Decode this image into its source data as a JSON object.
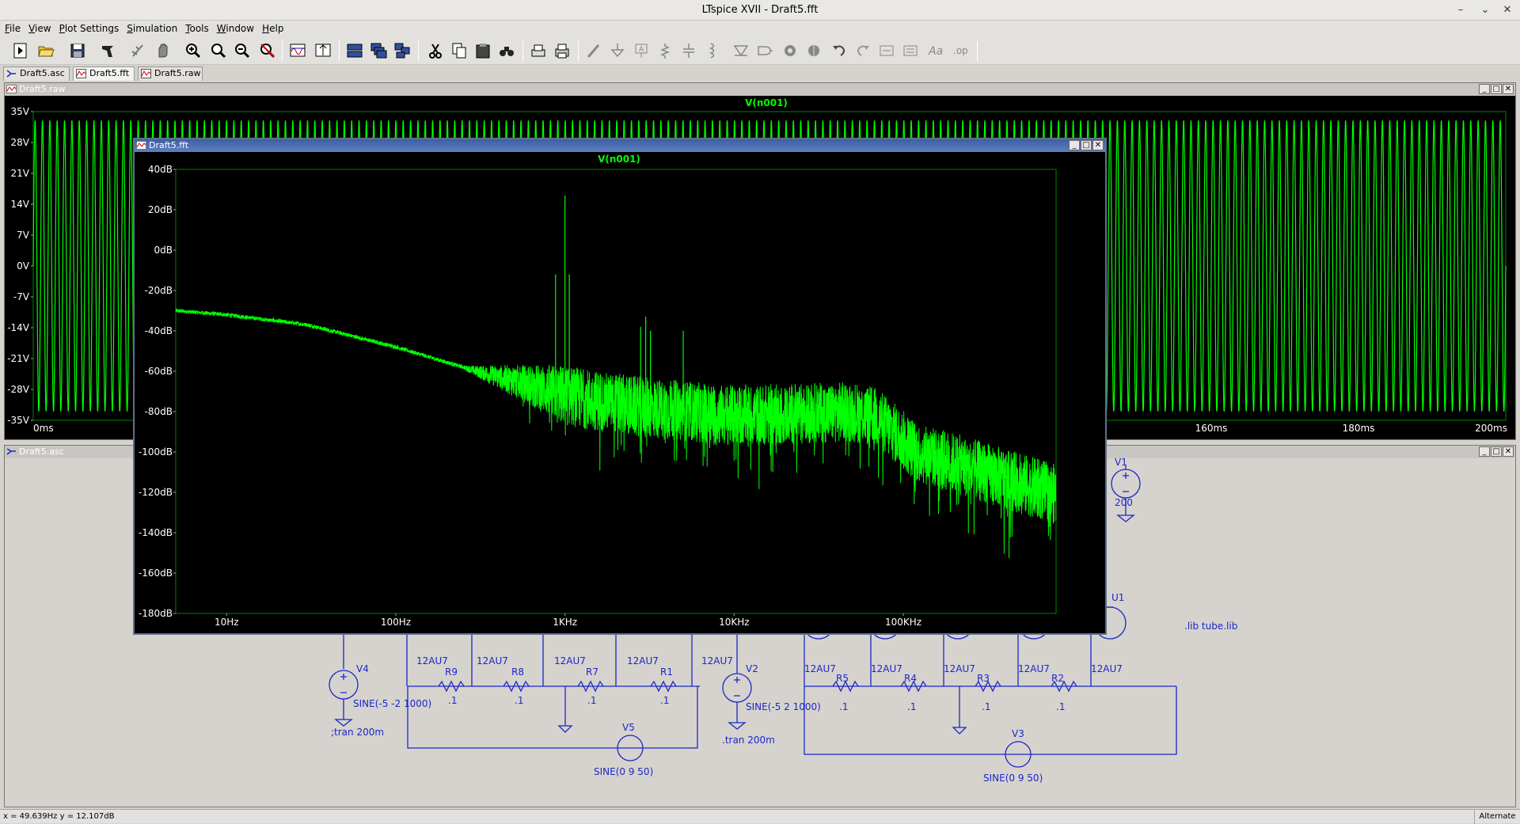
{
  "window": {
    "title": "LTspice XVII - Draft5.fft"
  },
  "menu": [
    "File",
    "View",
    "Plot Settings",
    "Simulation",
    "Tools",
    "Window",
    "Help"
  ],
  "toolbar_icons": [
    "new-schematic-icon",
    "open-icon",
    "save-icon",
    "control-panel-icon",
    "run-icon",
    "halt-icon",
    "zoom-in-icon",
    "zoom-fit-icon",
    "zoom-out-icon",
    "zoom-cancel-icon",
    "autorange-x-icon",
    "autorange-y-icon",
    "tile-horizontal-icon",
    "cascade-icon",
    "tile-vertical-icon",
    "cut-icon",
    "copy-icon",
    "paste-icon",
    "find-icon",
    "print-preview-icon",
    "print-icon",
    "wire-icon",
    "ground-icon",
    "label-net-icon",
    "resistor-icon",
    "capacitor-icon",
    "inductor-icon",
    "diode-icon",
    "component-icon",
    "rotate-icon",
    "mirror-icon",
    "undo-icon",
    "redo-icon",
    "move-icon",
    "drag-icon",
    "text-icon",
    "spice-directive-icon"
  ],
  "tabs": [
    {
      "label": "Draft5.asc",
      "icon": "schematic-icon"
    },
    {
      "label": "Draft5.fft",
      "icon": "waveform-icon"
    },
    {
      "label": "Draft5.raw",
      "icon": "waveform-icon"
    }
  ],
  "raw_window": {
    "title": "Draft5.raw",
    "chart_data": {
      "type": "line",
      "title": "V(n001)",
      "ylim": [
        -35,
        35
      ],
      "xlim": [
        0,
        200
      ],
      "x_unit": "ms",
      "y_ticks": [
        "35V",
        "28V",
        "21V",
        "14V",
        "7V",
        "0V",
        "-7V",
        "-14V",
        "-21V",
        "-28V",
        "-35V"
      ],
      "x_ticks": [
        "0ms",
        "160ms",
        "180ms",
        "200ms"
      ],
      "series": [
        {
          "name": "V(n001)",
          "waveform": "sine",
          "frequency_hz": 1000,
          "amplitude_v": 33,
          "color": "#00ff00"
        }
      ],
      "grid": false
    }
  },
  "fft_window": {
    "title": "Draft5.fft",
    "chart_data": {
      "type": "line",
      "title": "V(n001)",
      "x_scale": "log",
      "xlim": [
        5,
        800000
      ],
      "ylim": [
        -180,
        40
      ],
      "x_ticks": [
        "10Hz",
        "100Hz",
        "1KHz",
        "10KHz",
        "100KHz"
      ],
      "y_ticks": [
        "40dB",
        "20dB",
        "0dB",
        "-20dB",
        "-40dB",
        "-60dB",
        "-80dB",
        "-100dB",
        "-120dB",
        "-140dB",
        "-160dB",
        "-180dB"
      ],
      "series": [
        {
          "name": "V(n001)",
          "color": "#00ff00",
          "x": [
            5,
            10,
            30,
            100,
            300,
            700,
            1000,
            2000,
            3000,
            10000,
            50000,
            70000,
            120000,
            300000,
            800000
          ],
          "y": [
            -30,
            -32,
            -37,
            -48,
            -60,
            -68,
            -72,
            -76,
            -78,
            -82,
            -80,
            -83,
            -100,
            -110,
            -121
          ],
          "peaks": [
            {
              "x": 1000,
              "y": 27
            },
            {
              "x": 880,
              "y": -12
            },
            {
              "x": 1060,
              "y": -12
            },
            {
              "x": 3000,
              "y": -33
            },
            {
              "x": 2800,
              "y": -38
            },
            {
              "x": 3200,
              "y": -40
            },
            {
              "x": 5000,
              "y": -40
            }
          ]
        }
      ],
      "grid": false
    }
  },
  "asc_window": {
    "title": "Draft5.asc",
    "components": {
      "V1": {
        "name": "V1",
        "value": "200"
      },
      "V4": {
        "name": "V4",
        "value": "SINE(-5 -2 1000)",
        "directive": ";tran 200m"
      },
      "V2": {
        "name": "V2",
        "value": "SINE(-5 2 1000)",
        "directive": ".tran 200m"
      },
      "V5": {
        "name": "V5",
        "value": "SINE(0 9 50)"
      },
      "V3": {
        "name": "V3",
        "value": "SINE(0 9 50)"
      },
      "U1": {
        "name": "U1"
      },
      "lib": ".lib tube.lib",
      "tube_model": "12AU7",
      "left_resistors": [
        {
          "name": "R9",
          "value": ".1"
        },
        {
          "name": "R8",
          "value": ".1"
        },
        {
          "name": "R7",
          "value": ".1"
        },
        {
          "name": "R1",
          "value": ".1"
        }
      ],
      "right_resistors": [
        {
          "name": "R5",
          "value": ".1"
        },
        {
          "name": "R4",
          "value": ".1"
        },
        {
          "name": "R3",
          "value": ".1"
        },
        {
          "name": "R2",
          "value": ".1"
        }
      ]
    }
  },
  "status": {
    "coords": "x = 49.639Hz    y = 12.107dB",
    "mode": "Alternate"
  },
  "colors": {
    "trace": "#00ff00",
    "schematic": "#1b27c8",
    "plot_bg": "#000000",
    "active_title": "#3d60a3"
  }
}
